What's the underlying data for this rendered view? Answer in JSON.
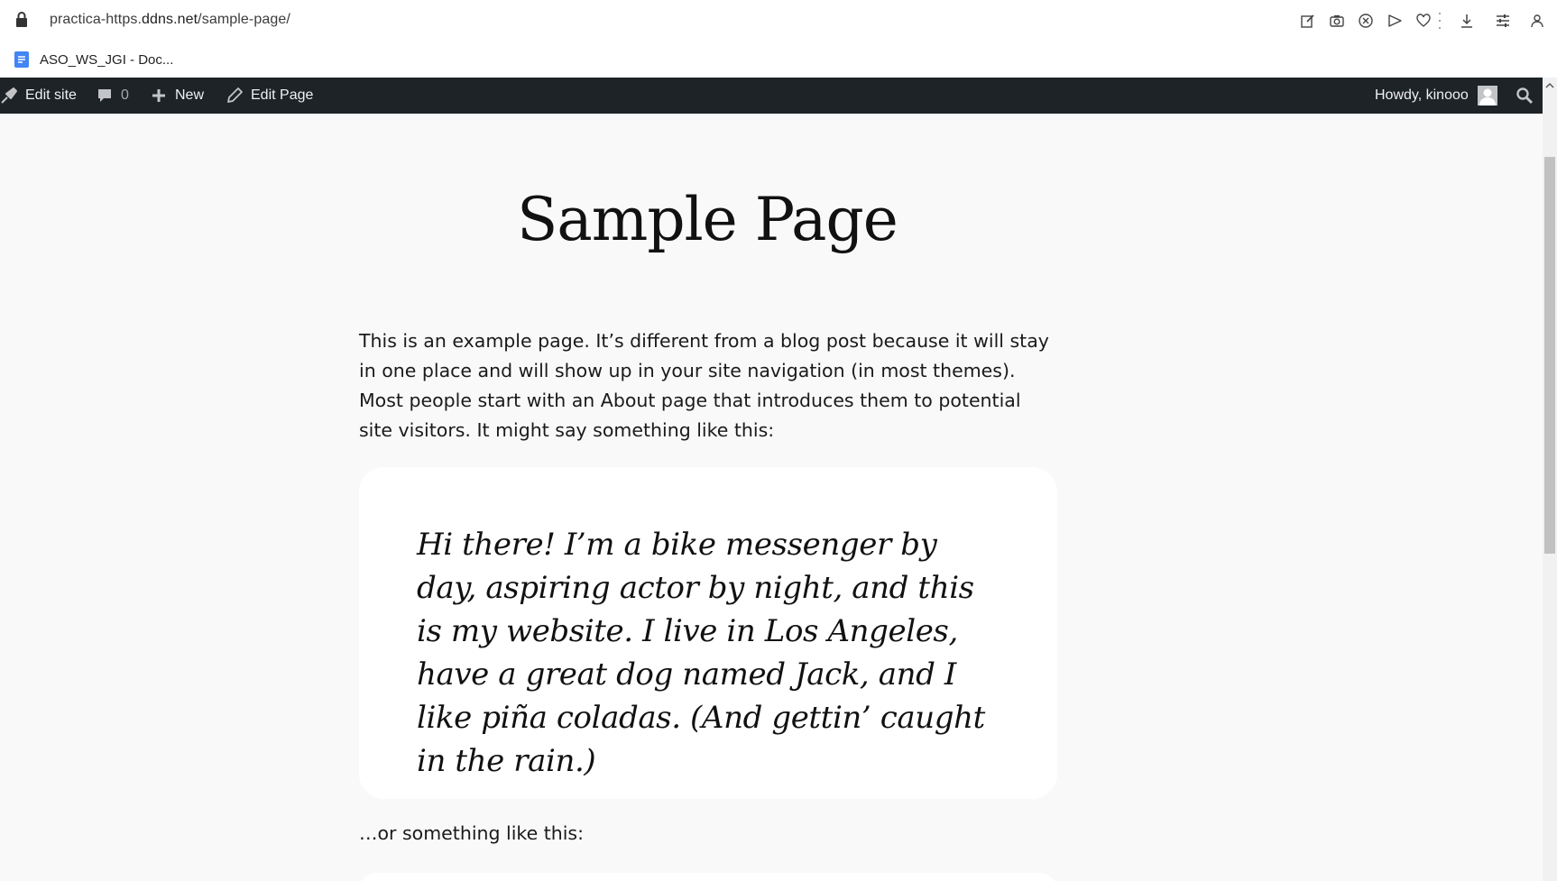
{
  "browser": {
    "url_prefix": "practica-https.",
    "url_host": "ddns.net",
    "url_path": "/sample-page/",
    "bookmark_label": "ASO_WS_JGI - Doc..."
  },
  "adminbar": {
    "edit_site": "Edit site",
    "comments_count": "0",
    "new_label": "New",
    "edit_page": "Edit Page",
    "howdy": "Howdy, kinooo"
  },
  "content": {
    "title": "Sample Page",
    "intro": "This is an example page. It’s different from a blog post because it will stay in one place and will show up in your site navigation (in most themes). Most people start with an About page that introduces them to potential site visitors. It might say something like this:",
    "quote": "Hi there! I’m a bike messenger by day, aspiring actor by night, and this is my website. I live in Los Angeles, have a great dog named Jack, and I like piña coladas. (And gettin’ caught in the rain.)",
    "after_quote": "…or something like this:"
  },
  "colors": {
    "adminbar_bg": "#1d2327",
    "page_bg": "#f9f9f9",
    "card_bg": "#ffffff"
  }
}
